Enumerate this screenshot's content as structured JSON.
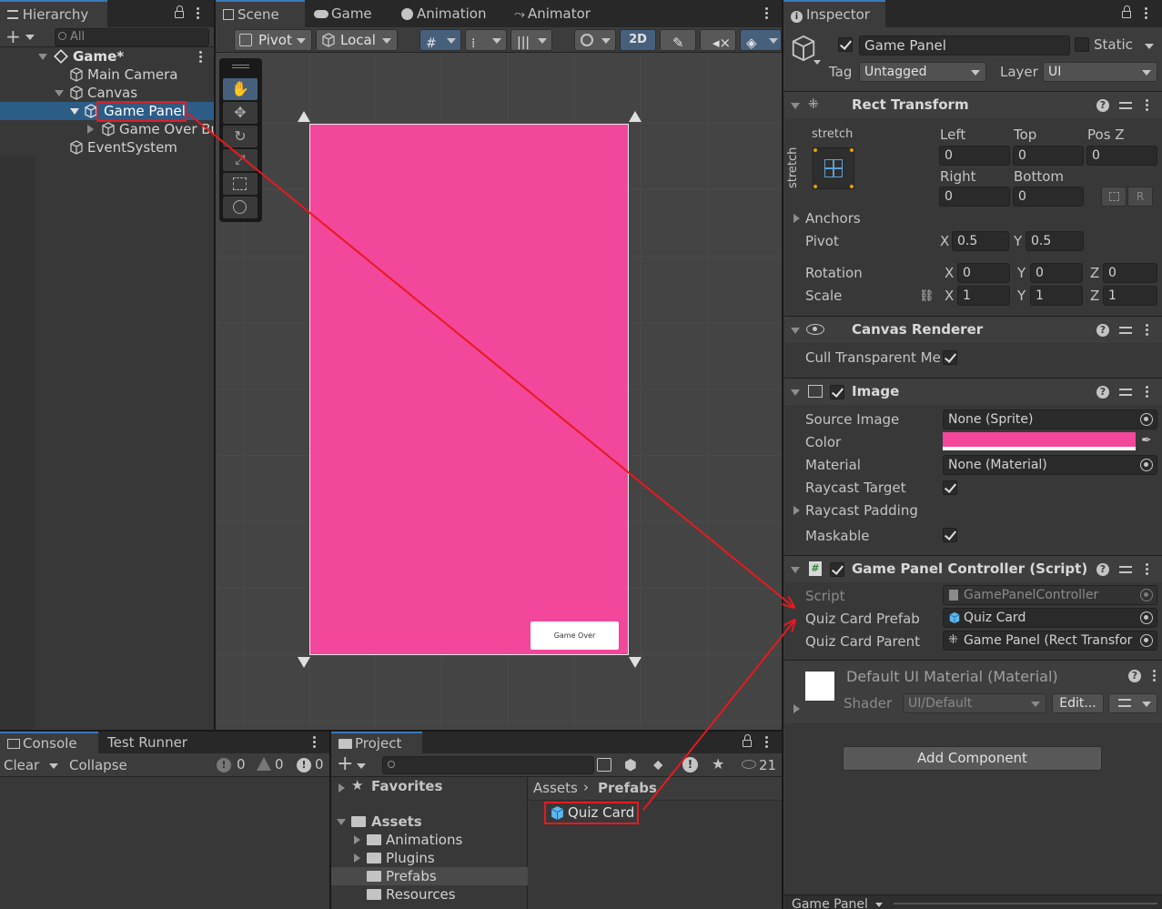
{
  "hierarchy": {
    "tab_label": "Hierarchy",
    "search_placeholder": "All",
    "items": [
      {
        "label": "Game*"
      },
      {
        "label": "Main Camera"
      },
      {
        "label": "Canvas"
      },
      {
        "label": "Game Panel"
      },
      {
        "label": "Game Over Bu"
      },
      {
        "label": "EventSystem"
      }
    ]
  },
  "scene": {
    "tabs": [
      "Scene",
      "Game",
      "Animation",
      "Animator"
    ],
    "toolbar": {
      "pivot": "Pivot",
      "local": "Local",
      "mode_2d": "2D"
    },
    "panel_color": "#f2479a",
    "button_label": "Game Over"
  },
  "inspector": {
    "tab_label": "Inspector",
    "object_name": "Game Panel",
    "static_label": "Static",
    "tag_label": "Tag",
    "tag_value": "Untagged",
    "layer_label": "Layer",
    "layer_value": "UI",
    "rect_transform": {
      "title": "Rect Transform",
      "stretch_top": "stretch",
      "stretch_side": "stretch",
      "left_label": "Left",
      "left": "0",
      "top_label": "Top",
      "top": "0",
      "posz_label": "Pos Z",
      "posz": "0",
      "right_label": "Right",
      "right": "0",
      "bottom_label": "Bottom",
      "bottom": "0",
      "anchors_label": "Anchors",
      "pivot_label": "Pivot",
      "pivot_x": "0.5",
      "pivot_y": "0.5",
      "rotation_label": "Rotation",
      "rot_x": "0",
      "rot_y": "0",
      "rot_z": "0",
      "scale_label": "Scale",
      "scale_x": "1",
      "scale_y": "1",
      "scale_z": "1",
      "x": "X",
      "y": "Y",
      "z": "Z",
      "r_btn": "R"
    },
    "canvas_renderer": {
      "title": "Canvas Renderer",
      "cull_label": "Cull Transparent Me"
    },
    "image": {
      "title": "Image",
      "source_label": "Source Image",
      "source_value": "None (Sprite)",
      "color_label": "Color",
      "color_value": "#f2479a",
      "material_label": "Material",
      "material_value": "None (Material)",
      "raycast_label": "Raycast Target",
      "raycast_padding_label": "Raycast Padding",
      "maskable_label": "Maskable"
    },
    "script": {
      "title": "Game Panel Controller (Script)",
      "script_label": "Script",
      "script_value": "GamePanelController",
      "prefab_label": "Quiz Card Prefab",
      "prefab_value": "Quiz Card",
      "parent_label": "Quiz Card Parent",
      "parent_value": "Game Panel (Rect Transfor"
    },
    "material": {
      "title": "Default UI Material (Material)",
      "shader_label": "Shader",
      "shader_value": "UI/Default",
      "edit_btn": "Edit..."
    },
    "add_component": "Add Component",
    "footer_label": "Game Panel"
  },
  "console": {
    "tabs": [
      "Console",
      "Test Runner"
    ],
    "clear": "Clear",
    "collapse": "Collapse",
    "count_info": "0",
    "count_warn": "0",
    "count_err": "0"
  },
  "project": {
    "tab_label": "Project",
    "count": "21",
    "favorites": "Favorites",
    "assets": "Assets",
    "folders": [
      "Animations",
      "Plugins",
      "Prefabs",
      "Resources"
    ],
    "breadcrumb_root": "Assets",
    "breadcrumb_current": "Prefabs",
    "asset_item": "Quiz Card"
  },
  "colors": {
    "accent": "#3a79bb",
    "annotation": "#e8191e",
    "selection": "#2c5d87"
  }
}
